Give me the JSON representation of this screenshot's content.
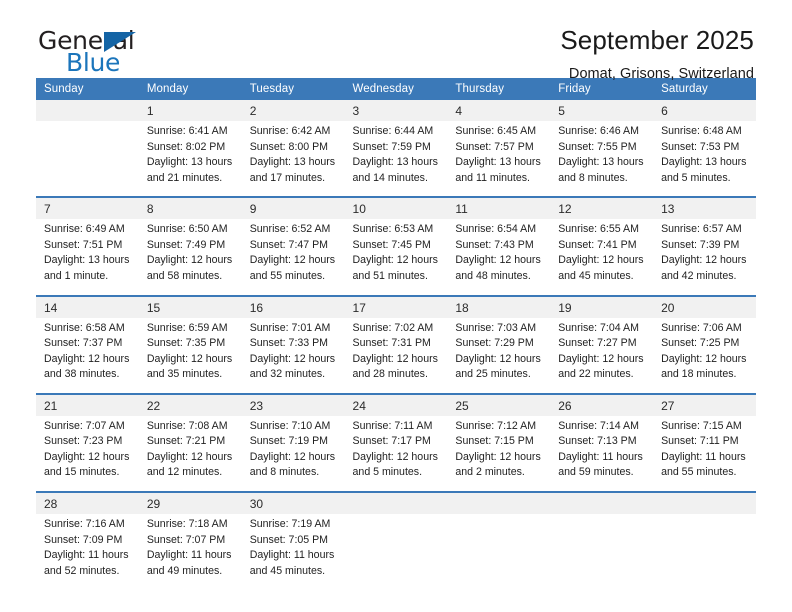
{
  "brand": {
    "name_part1": "General",
    "name_part2": "Blue",
    "triangle_color": "#1464a5",
    "blue_color": "#1b75bb"
  },
  "header": {
    "title": "September 2025",
    "subtitle": "Domat, Grisons, Switzerland"
  },
  "theme": {
    "header_bg": "#3b79b8",
    "daynum_bg": "#f1f1f1",
    "text": "#1f1f1f"
  },
  "weekday_headers": [
    "Sunday",
    "Monday",
    "Tuesday",
    "Wednesday",
    "Thursday",
    "Friday",
    "Saturday"
  ],
  "weeks": [
    {
      "days": [
        {
          "num": "",
          "sunrise": "",
          "sunset": "",
          "daylight1": "",
          "daylight2": ""
        },
        {
          "num": "1",
          "sunrise": "Sunrise: 6:41 AM",
          "sunset": "Sunset: 8:02 PM",
          "daylight1": "Daylight: 13 hours",
          "daylight2": "and 21 minutes."
        },
        {
          "num": "2",
          "sunrise": "Sunrise: 6:42 AM",
          "sunset": "Sunset: 8:00 PM",
          "daylight1": "Daylight: 13 hours",
          "daylight2": "and 17 minutes."
        },
        {
          "num": "3",
          "sunrise": "Sunrise: 6:44 AM",
          "sunset": "Sunset: 7:59 PM",
          "daylight1": "Daylight: 13 hours",
          "daylight2": "and 14 minutes."
        },
        {
          "num": "4",
          "sunrise": "Sunrise: 6:45 AM",
          "sunset": "Sunset: 7:57 PM",
          "daylight1": "Daylight: 13 hours",
          "daylight2": "and 11 minutes."
        },
        {
          "num": "5",
          "sunrise": "Sunrise: 6:46 AM",
          "sunset": "Sunset: 7:55 PM",
          "daylight1": "Daylight: 13 hours",
          "daylight2": "and 8 minutes."
        },
        {
          "num": "6",
          "sunrise": "Sunrise: 6:48 AM",
          "sunset": "Sunset: 7:53 PM",
          "daylight1": "Daylight: 13 hours",
          "daylight2": "and 5 minutes."
        }
      ]
    },
    {
      "days": [
        {
          "num": "7",
          "sunrise": "Sunrise: 6:49 AM",
          "sunset": "Sunset: 7:51 PM",
          "daylight1": "Daylight: 13 hours",
          "daylight2": "and 1 minute."
        },
        {
          "num": "8",
          "sunrise": "Sunrise: 6:50 AM",
          "sunset": "Sunset: 7:49 PM",
          "daylight1": "Daylight: 12 hours",
          "daylight2": "and 58 minutes."
        },
        {
          "num": "9",
          "sunrise": "Sunrise: 6:52 AM",
          "sunset": "Sunset: 7:47 PM",
          "daylight1": "Daylight: 12 hours",
          "daylight2": "and 55 minutes."
        },
        {
          "num": "10",
          "sunrise": "Sunrise: 6:53 AM",
          "sunset": "Sunset: 7:45 PM",
          "daylight1": "Daylight: 12 hours",
          "daylight2": "and 51 minutes."
        },
        {
          "num": "11",
          "sunrise": "Sunrise: 6:54 AM",
          "sunset": "Sunset: 7:43 PM",
          "daylight1": "Daylight: 12 hours",
          "daylight2": "and 48 minutes."
        },
        {
          "num": "12",
          "sunrise": "Sunrise: 6:55 AM",
          "sunset": "Sunset: 7:41 PM",
          "daylight1": "Daylight: 12 hours",
          "daylight2": "and 45 minutes."
        },
        {
          "num": "13",
          "sunrise": "Sunrise: 6:57 AM",
          "sunset": "Sunset: 7:39 PM",
          "daylight1": "Daylight: 12 hours",
          "daylight2": "and 42 minutes."
        }
      ]
    },
    {
      "days": [
        {
          "num": "14",
          "sunrise": "Sunrise: 6:58 AM",
          "sunset": "Sunset: 7:37 PM",
          "daylight1": "Daylight: 12 hours",
          "daylight2": "and 38 minutes."
        },
        {
          "num": "15",
          "sunrise": "Sunrise: 6:59 AM",
          "sunset": "Sunset: 7:35 PM",
          "daylight1": "Daylight: 12 hours",
          "daylight2": "and 35 minutes."
        },
        {
          "num": "16",
          "sunrise": "Sunrise: 7:01 AM",
          "sunset": "Sunset: 7:33 PM",
          "daylight1": "Daylight: 12 hours",
          "daylight2": "and 32 minutes."
        },
        {
          "num": "17",
          "sunrise": "Sunrise: 7:02 AM",
          "sunset": "Sunset: 7:31 PM",
          "daylight1": "Daylight: 12 hours",
          "daylight2": "and 28 minutes."
        },
        {
          "num": "18",
          "sunrise": "Sunrise: 7:03 AM",
          "sunset": "Sunset: 7:29 PM",
          "daylight1": "Daylight: 12 hours",
          "daylight2": "and 25 minutes."
        },
        {
          "num": "19",
          "sunrise": "Sunrise: 7:04 AM",
          "sunset": "Sunset: 7:27 PM",
          "daylight1": "Daylight: 12 hours",
          "daylight2": "and 22 minutes."
        },
        {
          "num": "20",
          "sunrise": "Sunrise: 7:06 AM",
          "sunset": "Sunset: 7:25 PM",
          "daylight1": "Daylight: 12 hours",
          "daylight2": "and 18 minutes."
        }
      ]
    },
    {
      "days": [
        {
          "num": "21",
          "sunrise": "Sunrise: 7:07 AM",
          "sunset": "Sunset: 7:23 PM",
          "daylight1": "Daylight: 12 hours",
          "daylight2": "and 15 minutes."
        },
        {
          "num": "22",
          "sunrise": "Sunrise: 7:08 AM",
          "sunset": "Sunset: 7:21 PM",
          "daylight1": "Daylight: 12 hours",
          "daylight2": "and 12 minutes."
        },
        {
          "num": "23",
          "sunrise": "Sunrise: 7:10 AM",
          "sunset": "Sunset: 7:19 PM",
          "daylight1": "Daylight: 12 hours",
          "daylight2": "and 8 minutes."
        },
        {
          "num": "24",
          "sunrise": "Sunrise: 7:11 AM",
          "sunset": "Sunset: 7:17 PM",
          "daylight1": "Daylight: 12 hours",
          "daylight2": "and 5 minutes."
        },
        {
          "num": "25",
          "sunrise": "Sunrise: 7:12 AM",
          "sunset": "Sunset: 7:15 PM",
          "daylight1": "Daylight: 12 hours",
          "daylight2": "and 2 minutes."
        },
        {
          "num": "26",
          "sunrise": "Sunrise: 7:14 AM",
          "sunset": "Sunset: 7:13 PM",
          "daylight1": "Daylight: 11 hours",
          "daylight2": "and 59 minutes."
        },
        {
          "num": "27",
          "sunrise": "Sunrise: 7:15 AM",
          "sunset": "Sunset: 7:11 PM",
          "daylight1": "Daylight: 11 hours",
          "daylight2": "and 55 minutes."
        }
      ]
    },
    {
      "days": [
        {
          "num": "28",
          "sunrise": "Sunrise: 7:16 AM",
          "sunset": "Sunset: 7:09 PM",
          "daylight1": "Daylight: 11 hours",
          "daylight2": "and 52 minutes."
        },
        {
          "num": "29",
          "sunrise": "Sunrise: 7:18 AM",
          "sunset": "Sunset: 7:07 PM",
          "daylight1": "Daylight: 11 hours",
          "daylight2": "and 49 minutes."
        },
        {
          "num": "30",
          "sunrise": "Sunrise: 7:19 AM",
          "sunset": "Sunset: 7:05 PM",
          "daylight1": "Daylight: 11 hours",
          "daylight2": "and 45 minutes."
        },
        {
          "num": "",
          "sunrise": "",
          "sunset": "",
          "daylight1": "",
          "daylight2": ""
        },
        {
          "num": "",
          "sunrise": "",
          "sunset": "",
          "daylight1": "",
          "daylight2": ""
        },
        {
          "num": "",
          "sunrise": "",
          "sunset": "",
          "daylight1": "",
          "daylight2": ""
        },
        {
          "num": "",
          "sunrise": "",
          "sunset": "",
          "daylight1": "",
          "daylight2": ""
        }
      ]
    }
  ]
}
